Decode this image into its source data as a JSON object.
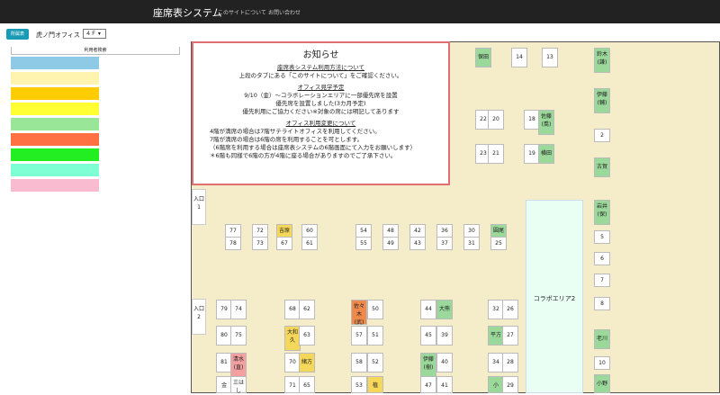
{
  "nav": {
    "brand": "座席表システム",
    "links": [
      "このサイトについて",
      "お問い合わせ"
    ]
  },
  "toolbar": {
    "dept_button": "所属表",
    "office_label": "虎ノ門オフィス",
    "floor_value": "４Ｆ ▾"
  },
  "sidebar": {
    "search_tab": "利用者検索",
    "legend_colors": [
      "#8ecae6",
      "#fff3b0",
      "#ffcc00",
      "#ffff33",
      "#99e699",
      "#ff7043",
      "#22ee22",
      "#7fffd4",
      "#f8bbd0"
    ]
  },
  "notice": {
    "title": "お知らせ",
    "h1": "座席表システム利用方法について",
    "p1": "上段のタブにある「このサイトについて」をご確認ください。",
    "h2": "オフィス見学予定",
    "p2": "9/10（金）～コラボレーションエリアに一部優先席を設置",
    "p3": "優先席を設置しました(3カ月予定)",
    "p4": "優先利用にご協力ください※対象の席には明記してあります",
    "h3": "オフィス利用変更について",
    "p5": "4階が満席の場合は7階サテライトオフィスを利用してください。",
    "p6": "7階が満席の場合は6階の席を利用することを可とします。",
    "p7": "（6階席を利用する場合は座席表システムの6階画面にて入力をお願いします）",
    "p8": "＊6階も同様で6階の方が4階に座る場合がありますのでご了承下さい。"
  },
  "floor": {
    "entrance1": "入口1",
    "entrance2": "入口2",
    "collab": "コラボエリア2",
    "seats": [
      {
        "t": "保田",
        "c": "green"
      },
      {
        "t": "14",
        "c": ""
      },
      {
        "t": "13",
        "c": ""
      },
      {
        "t": "鈴木(謙)",
        "c": "green"
      },
      {
        "t": "22",
        "c": ""
      },
      {
        "t": "20",
        "c": ""
      },
      {
        "t": "18",
        "c": ""
      },
      {
        "t": "佐藤(喬)",
        "c": "green"
      },
      {
        "t": "23",
        "c": ""
      },
      {
        "t": "21",
        "c": ""
      },
      {
        "t": "19",
        "c": ""
      },
      {
        "t": "横田",
        "c": "green"
      },
      {
        "t": "伊藤(輔)",
        "c": "green"
      },
      {
        "t": "2",
        "c": ""
      },
      {
        "t": "古賀",
        "c": "green"
      },
      {
        "t": "77",
        "c": ""
      },
      {
        "t": "72",
        "c": ""
      },
      {
        "t": "吉原",
        "c": "yellow"
      },
      {
        "t": "60",
        "c": ""
      },
      {
        "t": "78",
        "c": ""
      },
      {
        "t": "73",
        "c": ""
      },
      {
        "t": "67",
        "c": ""
      },
      {
        "t": "61",
        "c": ""
      },
      {
        "t": "54",
        "c": ""
      },
      {
        "t": "48",
        "c": ""
      },
      {
        "t": "42",
        "c": ""
      },
      {
        "t": "36",
        "c": ""
      },
      {
        "t": "30",
        "c": ""
      },
      {
        "t": "圓尾",
        "c": "green"
      },
      {
        "t": "55",
        "c": ""
      },
      {
        "t": "49",
        "c": ""
      },
      {
        "t": "43",
        "c": ""
      },
      {
        "t": "37",
        "c": ""
      },
      {
        "t": "31",
        "c": ""
      },
      {
        "t": "25",
        "c": ""
      },
      {
        "t": "岩井(保)",
        "c": "green"
      },
      {
        "t": "5",
        "c": ""
      },
      {
        "t": "6",
        "c": ""
      },
      {
        "t": "7",
        "c": ""
      },
      {
        "t": "8",
        "c": ""
      },
      {
        "t": "老川",
        "c": "green"
      },
      {
        "t": "10",
        "c": ""
      },
      {
        "t": "小野",
        "c": "green"
      },
      {
        "t": "79",
        "c": ""
      },
      {
        "t": "74",
        "c": ""
      },
      {
        "t": "80",
        "c": ""
      },
      {
        "t": "75",
        "c": ""
      },
      {
        "t": "81",
        "c": ""
      },
      {
        "t": "清水(直)",
        "c": "pink"
      },
      {
        "t": "金",
        "c": ""
      },
      {
        "t": "三はし",
        "c": ""
      },
      {
        "t": "68",
        "c": ""
      },
      {
        "t": "62",
        "c": ""
      },
      {
        "t": "大和久",
        "c": "yellow"
      },
      {
        "t": "63",
        "c": ""
      },
      {
        "t": "70",
        "c": ""
      },
      {
        "t": "緒方",
        "c": "yellow"
      },
      {
        "t": "71",
        "c": ""
      },
      {
        "t": "65",
        "c": ""
      },
      {
        "t": "佐々木(武)",
        "c": "orange"
      },
      {
        "t": "50",
        "c": ""
      },
      {
        "t": "57",
        "c": ""
      },
      {
        "t": "51",
        "c": ""
      },
      {
        "t": "58",
        "c": ""
      },
      {
        "t": "52",
        "c": ""
      },
      {
        "t": "植",
        "c": "yellow"
      },
      {
        "t": "53",
        "c": ""
      },
      {
        "t": "44",
        "c": ""
      },
      {
        "t": "大熊",
        "c": "green"
      },
      {
        "t": "45",
        "c": ""
      },
      {
        "t": "39",
        "c": ""
      },
      {
        "t": "伊藤(樹)",
        "c": "green"
      },
      {
        "t": "40",
        "c": ""
      },
      {
        "t": "47",
        "c": ""
      },
      {
        "t": "41",
        "c": ""
      },
      {
        "t": "32",
        "c": ""
      },
      {
        "t": "26",
        "c": ""
      },
      {
        "t": "平方",
        "c": "green"
      },
      {
        "t": "27",
        "c": ""
      },
      {
        "t": "34",
        "c": ""
      },
      {
        "t": "28",
        "c": ""
      },
      {
        "t": "小",
        "c": "green"
      },
      {
        "t": "29",
        "c": ""
      }
    ]
  }
}
